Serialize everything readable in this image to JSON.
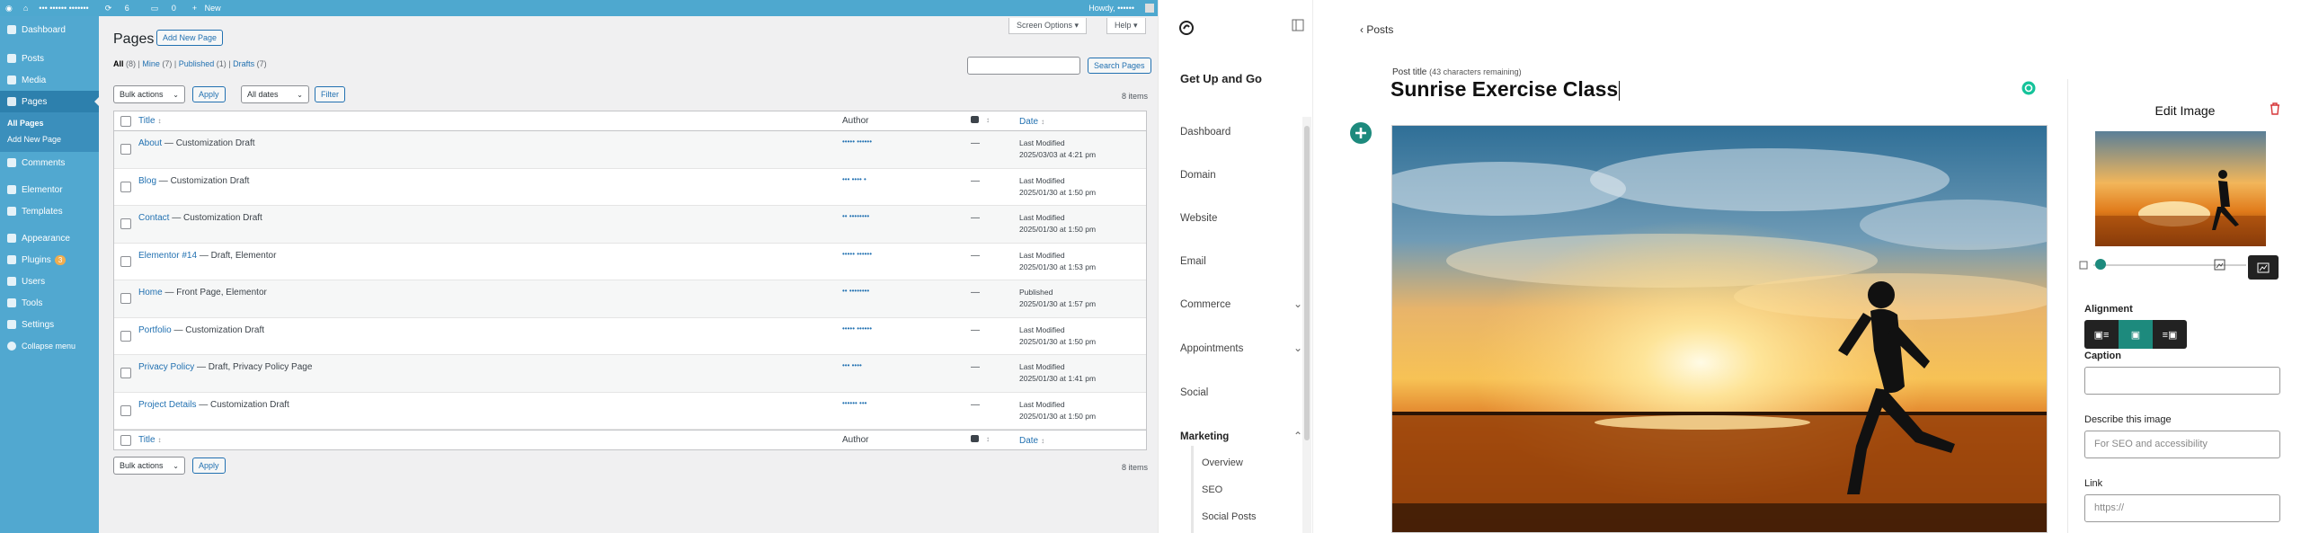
{
  "adminbar": {
    "site_name": "••• •••••• •••••••",
    "updates": "6",
    "comments": "0",
    "new_label": "New",
    "howdy": "Howdy, ••••••"
  },
  "wp_sidebar": {
    "items": [
      {
        "label": "Dashboard"
      },
      {
        "label": "Posts"
      },
      {
        "label": "Media"
      },
      {
        "label": "Pages"
      },
      {
        "label": "Comments"
      },
      {
        "label": "Elementor"
      },
      {
        "label": "Templates"
      },
      {
        "label": "Appearance"
      },
      {
        "label": "Plugins",
        "badge": "3"
      },
      {
        "label": "Users"
      },
      {
        "label": "Tools"
      },
      {
        "label": "Settings"
      },
      {
        "label": "Collapse menu"
      }
    ],
    "sub_all_pages": "All Pages",
    "sub_add_new": "Add New Page"
  },
  "pages": {
    "title": "Pages",
    "add_new": "Add New Page",
    "screen_options": "Screen Options ▾",
    "help": "Help ▾",
    "filters": {
      "all": "All",
      "all_count": "(8)",
      "mine": "Mine",
      "mine_count": "(7)",
      "published": "Published",
      "published_count": "(1)",
      "drafts": "Drafts",
      "drafts_count": "(7)"
    },
    "search_button": "Search Pages",
    "bulk_actions": "Bulk actions",
    "apply": "Apply",
    "all_dates": "All dates",
    "filter": "Filter",
    "items_count": "8 items",
    "col_title": "Title",
    "col_author": "Author",
    "col_date": "Date",
    "sort_icon": "↕",
    "rows": [
      {
        "title": "About",
        "state": " — Customization Draft",
        "author": "••••• ••••••",
        "comments": "—",
        "status": "Last Modified",
        "date": "2025/03/03 at 4:21 pm"
      },
      {
        "title": "Blog",
        "state": " — Customization Draft",
        "author": "••• •••• •",
        "comments": "—",
        "status": "Last Modified",
        "date": "2025/01/30 at 1:50 pm"
      },
      {
        "title": "Contact",
        "state": " — Customization Draft",
        "author": "•• ••••••••",
        "comments": "—",
        "status": "Last Modified",
        "date": "2025/01/30 at 1:50 pm"
      },
      {
        "title": "Elementor #14",
        "state": " — Draft, Elementor",
        "author": "••••• ••••••",
        "comments": "—",
        "status": "Last Modified",
        "date": "2025/01/30 at 1:53 pm"
      },
      {
        "title": "Home",
        "state": " — Front Page, Elementor",
        "author": "•• ••••••••",
        "comments": "—",
        "status": "Published",
        "date": "2025/01/30 at 1:57 pm"
      },
      {
        "title": "Portfolio",
        "state": " — Customization Draft",
        "author": "••••• ••••••",
        "comments": "—",
        "status": "Last Modified",
        "date": "2025/01/30 at 1:50 pm"
      },
      {
        "title": "Privacy Policy",
        "state": " — Draft, Privacy Policy Page",
        "author": "••• ••••",
        "comments": "—",
        "status": "Last Modified",
        "date": "2025/01/30 at 1:41 pm"
      },
      {
        "title": "Project Details",
        "state": " — Customization Draft",
        "author": "•••••• •••",
        "comments": "—",
        "status": "Last Modified",
        "date": "2025/01/30 at 1:50 pm"
      }
    ]
  },
  "site_nav": {
    "site_name": "Get Up and Go",
    "items": [
      "Dashboard",
      "Domain",
      "Website",
      "Email",
      "Commerce",
      "Appointments",
      "Social",
      "Marketing"
    ],
    "marketing_sub": [
      "Overview",
      "SEO",
      "Social Posts"
    ]
  },
  "post_editor": {
    "back": "Posts",
    "post_title_label": "Post title",
    "chars_remaining": "(43 characters remaining)",
    "post_title": "Sunrise Exercise Class"
  },
  "edit_image": {
    "heading": "Edit Image",
    "alignment": "Alignment",
    "caption": "Caption",
    "caption_value": "",
    "describe": "Describe this image",
    "describe_placeholder": "For SEO and accessibility",
    "link": "Link",
    "link_placeholder": "https://",
    "zoom_level": 0.05
  },
  "colors": {
    "wp_blue": "#51a8d0",
    "wp_link": "#2271b1",
    "accent_teal": "#1d8a7d",
    "dark": "#222222"
  }
}
